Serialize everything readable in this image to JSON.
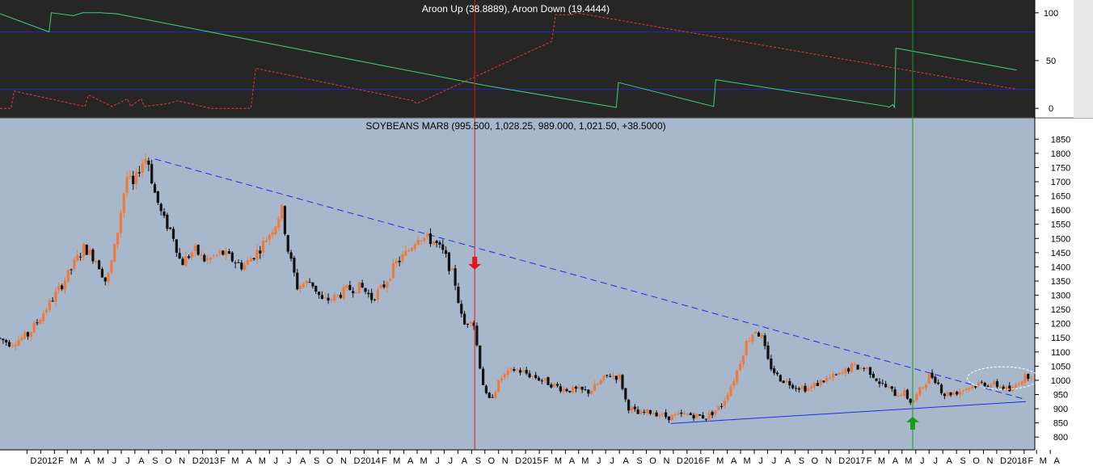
{
  "chart_data": [
    {
      "type": "line",
      "panel": "indicator",
      "title": "Aroon Up (38.8889), Aroon Down (19.4444)",
      "ylim": [
        -10,
        110
      ],
      "y_ticks": [
        0,
        50,
        100
      ],
      "levels": [
        80,
        20
      ],
      "colors": {
        "background": "#262626",
        "up": "#3fd07a",
        "down": "#e03c3c",
        "level": "#2020d0"
      },
      "series": [
        {
          "role": "up",
          "x": [
            "2011-10-01",
            "2012-01-20",
            "2012-01-25",
            "2012-03-15",
            "2012-04-05",
            "2012-05-15",
            "2012-06-20",
            "2014-10-01",
            "2015-07-25",
            "2015-07-30",
            "2016-03-01",
            "2016-03-06",
            "2017-03-29",
            "2017-04-01",
            "2017-04-10",
            "2017-04-14",
            "2017-04-17",
            "2018-01-15"
          ],
          "values": [
            99,
            80,
            100,
            97,
            100,
            100,
            99,
            24,
            1,
            27,
            2,
            30,
            2,
            1,
            4,
            1,
            63,
            40
          ]
        },
        {
          "role": "down",
          "x": [
            "2011-10-01",
            "2011-10-26",
            "2011-11-02",
            "2012-04-10",
            "2012-04-18",
            "2012-06-10",
            "2012-07-15",
            "2012-07-22",
            "2012-08-15",
            "2012-08-22",
            "2012-10-15",
            "2012-11-05",
            "2013-01-20",
            "2013-01-28",
            "2013-04-20",
            "2013-05-01",
            "2014-04-22",
            "2014-04-30",
            "2015-03-01",
            "2015-03-10",
            "2015-04-18",
            "2015-04-25",
            "2018-01-15"
          ],
          "values": [
            0,
            0,
            18,
            2,
            14,
            2,
            10,
            2,
            10,
            2,
            5,
            8,
            0,
            0,
            0,
            42,
            8,
            5,
            70,
            98,
            98,
            100,
            20
          ]
        }
      ]
    },
    {
      "type": "candlestick",
      "panel": "price",
      "title": "SOYBEANS MAR8 (995.500, 1,028.25, 989.000, 1,021.50, +38.5000)",
      "ylim": [
        755,
        1885
      ],
      "y_ticks": [
        800,
        850,
        900,
        950,
        1000,
        1050,
        1100,
        1150,
        1200,
        1250,
        1300,
        1350,
        1400,
        1450,
        1500,
        1550,
        1600,
        1650,
        1700,
        1750,
        1800,
        1850
      ],
      "x_start": "2011-10-01",
      "x_end": "2018-02-25",
      "x_ticks": [
        "D",
        "2012",
        "F",
        "M",
        "A",
        "M",
        "J",
        "J",
        "A",
        "S",
        "O",
        "N",
        "D",
        "2013",
        "F",
        "M",
        "A",
        "M",
        "J",
        "J",
        "A",
        "S",
        "O",
        "N",
        "D",
        "2014",
        "F",
        "M",
        "A",
        "M",
        "J",
        "J",
        "A",
        "S",
        "O",
        "N",
        "D",
        "2015",
        "F",
        "M",
        "A",
        "M",
        "J",
        "J",
        "A",
        "S",
        "O",
        "N",
        "D",
        "2016",
        "F",
        "M",
        "A",
        "M",
        "J",
        "J",
        "A",
        "S",
        "O",
        "N",
        "D",
        "2017",
        "F",
        "M",
        "A",
        "M",
        "J",
        "J",
        "A",
        "S",
        "O",
        "N",
        "D",
        "2018",
        "F",
        "M",
        "A"
      ],
      "ohlc_path": [
        [
          "2011-10-01",
          1150
        ],
        [
          "2011-11-01",
          1130
        ],
        [
          "2011-12-10",
          1160
        ],
        [
          "2012-01-15",
          1240
        ],
        [
          "2012-03-01",
          1350
        ],
        [
          "2012-04-15",
          1470
        ],
        [
          "2012-05-15",
          1420
        ],
        [
          "2012-06-05",
          1340
        ],
        [
          "2012-06-25",
          1480
        ],
        [
          "2012-07-20",
          1720
        ],
        [
          "2012-08-05",
          1680
        ],
        [
          "2012-08-20",
          1760
        ],
        [
          "2012-09-05",
          1790
        ],
        [
          "2012-09-20",
          1670
        ],
        [
          "2012-10-10",
          1570
        ],
        [
          "2012-11-01",
          1520
        ],
        [
          "2012-11-20",
          1410
        ],
        [
          "2012-12-20",
          1460
        ],
        [
          "2013-01-15",
          1420
        ],
        [
          "2013-02-20",
          1450
        ],
        [
          "2013-04-10",
          1400
        ],
        [
          "2013-05-20",
          1470
        ],
        [
          "2013-06-25",
          1560
        ],
        [
          "2013-07-05",
          1610
        ],
        [
          "2013-07-20",
          1460
        ],
        [
          "2013-08-10",
          1330
        ],
        [
          "2013-09-10",
          1350
        ],
        [
          "2013-10-05",
          1280
        ],
        [
          "2013-11-01",
          1290
        ],
        [
          "2013-12-01",
          1320
        ],
        [
          "2014-01-01",
          1330
        ],
        [
          "2014-01-25",
          1290
        ],
        [
          "2014-02-20",
          1330
        ],
        [
          "2014-03-20",
          1410
        ],
        [
          "2014-04-15",
          1450
        ],
        [
          "2014-05-10",
          1510
        ],
        [
          "2014-06-15",
          1490
        ],
        [
          "2014-07-10",
          1440
        ],
        [
          "2014-08-01",
          1350
        ],
        [
          "2014-08-20",
          1190
        ],
        [
          "2014-09-10",
          1230
        ],
        [
          "2014-09-25",
          1070
        ],
        [
          "2014-10-05",
          980
        ],
        [
          "2014-10-15",
          920
        ],
        [
          "2014-11-15",
          1010
        ],
        [
          "2014-12-15",
          1040
        ],
        [
          "2015-02-01",
          1010
        ],
        [
          "2015-04-01",
          970
        ],
        [
          "2015-06-01",
          960
        ],
        [
          "2015-07-15",
          1020
        ],
        [
          "2015-08-10",
          1010
        ],
        [
          "2015-08-25",
          910
        ],
        [
          "2015-09-20",
          880
        ],
        [
          "2015-10-20",
          890
        ],
        [
          "2015-11-25",
          870
        ],
        [
          "2016-01-10",
          880
        ],
        [
          "2016-02-20",
          870
        ],
        [
          "2016-03-25",
          910
        ],
        [
          "2016-04-25",
          1010
        ],
        [
          "2016-05-20",
          1130
        ],
        [
          "2016-06-10",
          1180
        ],
        [
          "2016-06-25",
          1150
        ],
        [
          "2016-07-10",
          1060
        ],
        [
          "2016-08-01",
          1010
        ],
        [
          "2016-09-10",
          980
        ],
        [
          "2016-10-10",
          970
        ],
        [
          "2016-11-10",
          1000
        ],
        [
          "2016-12-20",
          1020
        ],
        [
          "2017-01-15",
          1050
        ],
        [
          "2017-02-20",
          1040
        ],
        [
          "2017-03-20",
          990
        ],
        [
          "2017-04-25",
          950
        ],
        [
          "2017-05-10",
          960
        ],
        [
          "2017-05-30",
          920
        ],
        [
          "2017-06-20",
          970
        ],
        [
          "2017-07-10",
          1020
        ],
        [
          "2017-07-25",
          1000
        ],
        [
          "2017-08-10",
          950
        ],
        [
          "2017-09-10",
          960
        ],
        [
          "2017-10-10",
          980
        ],
        [
          "2017-11-10",
          990
        ],
        [
          "2017-12-15",
          980
        ],
        [
          "2018-01-10",
          960
        ],
        [
          "2018-01-25",
          995
        ],
        [
          "2018-02-20",
          1021
        ]
      ],
      "trendlines": [
        {
          "style": "dashed",
          "x": [
            "2012-09-15",
            "2018-01-30"
          ],
          "values": [
            1780,
            935
          ]
        },
        {
          "style": "solid",
          "x": [
            "2015-11-25",
            "2018-02-05"
          ],
          "values": [
            848,
            925
          ]
        }
      ],
      "markers": [
        {
          "x": "2014-09-08",
          "direction": "down",
          "color": "#e8141a",
          "value": 1390
        },
        {
          "x": "2017-05-25",
          "direction": "up",
          "color": "#1a9a1a",
          "value": 872
        }
      ],
      "annotation": {
        "x": "2017-12-15",
        "value": 1008,
        "shape": "ellipse"
      },
      "vlines": [
        {
          "x": "2014-09-08",
          "color": "#e8141a"
        },
        {
          "x": "2017-05-25",
          "color": "#1a9a1a"
        }
      ],
      "colors": {
        "background": "#a8b8cc",
        "up": "#f07a3a",
        "down": "#101010",
        "trend": "#1e2ee6"
      }
    }
  ]
}
